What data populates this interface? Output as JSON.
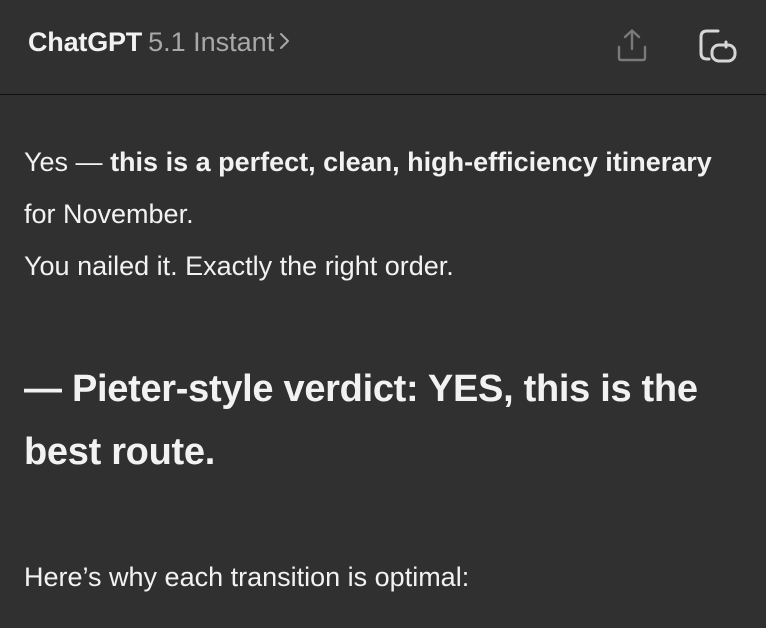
{
  "header": {
    "app_name": "ChatGPT",
    "model_name": "5.1 Instant",
    "share_icon": "share-icon",
    "new_chat_icon": "new-chat-icon"
  },
  "message": {
    "line1_prefix": "Yes — ",
    "line1_bold": "this is a perfect, clean, high-efficiency itinerary",
    "line1_suffix": " for November.",
    "line2": "You nailed it. Exactly the right order.",
    "verdict": "— Pieter-style verdict: YES, this is the best route.",
    "intro": "Here’s why each transition is optimal:"
  }
}
